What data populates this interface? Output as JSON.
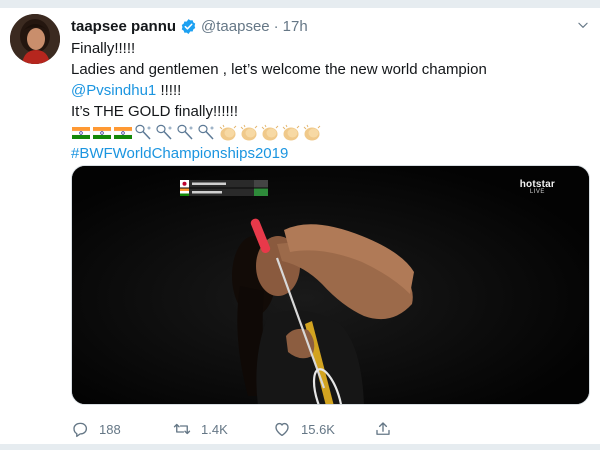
{
  "tweet": {
    "author_name": "taapsee pannu",
    "handle": "@taapsee",
    "separator": "·",
    "time": "17h",
    "lines": {
      "l1": "Finally!!!!!",
      "l2": "Ladies and gentlemen , let’s welcome the new world champion",
      "mention": "@Pvsindhu1",
      "l3_suffix": " !!!!!",
      "l4": "It’s THE GOLD finally!!!!!!",
      "hashtag": "#BWFWorldChampionships2019"
    },
    "emoji_row": [
      "flag-india-icon",
      "flag-india-icon",
      "flag-india-icon",
      "badminton-icon",
      "badminton-icon",
      "badminton-icon",
      "badminton-icon",
      "clapping-hands-icon",
      "clapping-hands-icon",
      "clapping-hands-icon",
      "clapping-hands-icon",
      "clapping-hands-icon"
    ]
  },
  "media": {
    "overlay_brand": "hotstar",
    "overlay_live": "LIVE"
  },
  "actions": {
    "reply_count": "188",
    "retweet_count": "1.4K",
    "like_count": "15.6K"
  },
  "colors": {
    "link": "#1b95e0",
    "muted": "#657786",
    "verified": "#1da1f2",
    "racket_handle": "#e8394a"
  }
}
